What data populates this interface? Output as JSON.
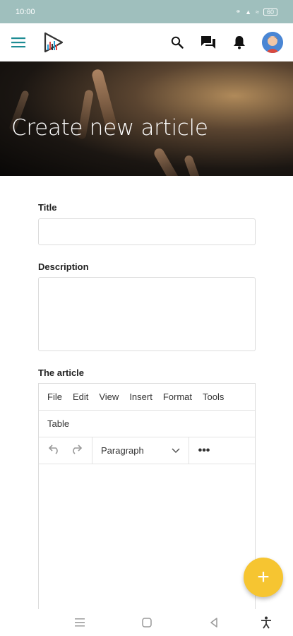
{
  "status_bar": {
    "time": "10:00",
    "battery": "60"
  },
  "app_bar": {
    "menu_icon": "hamburger-menu-icon",
    "logo_icon": "app-logo-icon",
    "search_icon": "search-icon",
    "chat_icon": "chat-icon",
    "notification_icon": "bell-icon",
    "avatar_icon": "user-avatar-icon",
    "accent": "#1e8c94"
  },
  "hero": {
    "title": "Create new article"
  },
  "form": {
    "title_label": "Title",
    "title_value": "",
    "description_label": "Description",
    "description_value": "",
    "article_label": "The article"
  },
  "editor": {
    "menus": [
      "File",
      "Edit",
      "View",
      "Insert",
      "Format",
      "Tools"
    ],
    "menu_row2": "Table",
    "block_format": "Paragraph",
    "undo_icon": "undo-icon",
    "redo_icon": "redo-icon",
    "more_icon": "more-horizontal-icon",
    "content": ""
  },
  "fab": {
    "label": "+",
    "color": "#f6c531"
  },
  "nav_bar": {
    "icons": [
      "recent-apps-icon",
      "home-icon",
      "back-icon",
      "accessibility-icon"
    ]
  }
}
